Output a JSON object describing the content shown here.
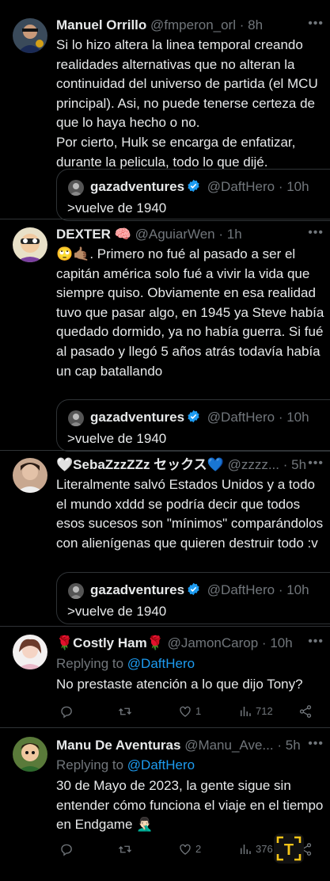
{
  "tweets": [
    {
      "name": "Manuel Orrillo",
      "handle": "@fmperon_orl",
      "time": "8h",
      "text": "Si lo hizo altera la linea temporal creando realidades alternativas que no alteran la continuidad del universo de partida (el MCU principal). Asi, no puede tenerse certeza de que lo haya hecho o no.\nPor cierto, Hulk se encarga de enfatizar, durante la pelicula, todo lo que dijé.",
      "quote": {
        "name": "gazadventures",
        "handle": "@DaftHero",
        "time": "10h",
        "text": ">vuelve de 1940"
      }
    },
    {
      "name": "DEXTER",
      "handle": "@AguiarWen",
      "time": "1h",
      "text": "🙄🤙🏽. Primero no fué al pasado a ser el capitán américa solo fué a vivir la vida que siempre quiso. Obviamente en esa realidad tuvo que pasar algo, en 1945 ya Steve había quedado dormido, ya no había guerra. Si fué al pasado y llegó 5 años atrás todavía había un cap batallando",
      "quote": {
        "name": "gazadventures",
        "handle": "@DaftHero",
        "time": "10h",
        "text": ">vuelve de 1940"
      }
    },
    {
      "name": "🤍SebaZzzZZz セックス💙",
      "handle": "@zzzz...",
      "time": "5h",
      "text": "Literalmente salvó Estados Unidos y a todo el mundo xddd se podría decir que todos esos sucesos son \"mínimos\" comparándolos con alienígenas que quieren destruir todo :v",
      "quote": {
        "name": "gazadventures",
        "handle": "@DaftHero",
        "time": "10h",
        "text": ">vuelve de 1940"
      }
    },
    {
      "name": "🌹Costly Ham🌹",
      "handle": "@JamonCarop",
      "time": "10h",
      "replying_prefix": "Replying to",
      "replying_to": "@DaftHero",
      "text": "No prestaste atención a lo que dijo Tony?",
      "actions": {
        "replies": "",
        "retweets": "",
        "likes": "1",
        "views": "712"
      }
    },
    {
      "name": "Manu De Aventuras",
      "handle": "@Manu_Ave...",
      "time": "5h",
      "replying_prefix": "Replying to",
      "replying_to": "@DaftHero",
      "text": "30 de Mayo de 2023, la gente sigue sin entender cómo funciona el viaje en el tiempo en Endgame 🤦🏻‍♂️",
      "actions": {
        "replies": "",
        "retweets": "",
        "likes": "2",
        "views": "376"
      }
    }
  ],
  "colors": {
    "background": "#000000",
    "text": "#e7e9ea",
    "muted": "#71767b",
    "link": "#1d9bf0",
    "verified": "#1d9bf0",
    "border": "#2f3336"
  },
  "icons": [
    "reply-icon",
    "retweet-icon",
    "like-icon",
    "views-icon",
    "share-icon",
    "verified-badge-icon",
    "more-icon"
  ],
  "watermark": "T"
}
